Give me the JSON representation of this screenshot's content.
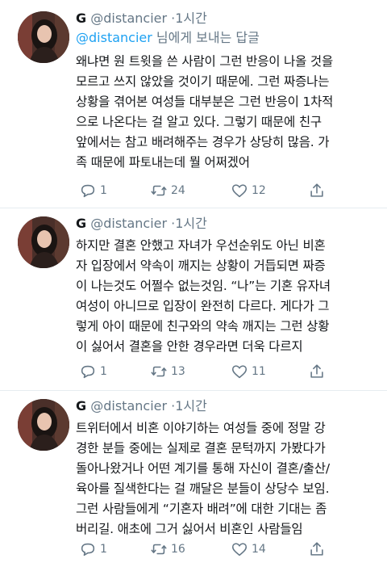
{
  "colors": {
    "link": "#1da1f2",
    "meta": "#657786",
    "text": "#14171a"
  },
  "tweets": [
    {
      "name": "G",
      "handle": "@distancier",
      "separator": "·",
      "time": "1시간",
      "reply_mention": "@distancier",
      "reply_suffix": " 님에게 보내는 답글",
      "body": "왜냐면 원 트윗을 쓴 사람이 그런 반응이 나올 것을\n모르고 쓰지 않았을 것이기 때문에. 그런 짜증나는\n상황을 겪어본 여성들 대부분은 그런 반응이 1차적\n으로 나온다는 걸 알고 있다. 그렇기 때문에 친구\n앞에서는 참고 배려해주는 경우가 상당히 많음. 가\n족 때문에 파토내는데 뭘 어쩌겠어",
      "replies": "1",
      "retweets": "24",
      "likes": "12"
    },
    {
      "name": "G",
      "handle": "@distancier",
      "separator": "·",
      "time": "1시간",
      "body": "하지만 결혼 안했고 자녀가 우선순위도 아닌 비혼\n자 입장에서 약속이 깨지는 상황이 거듭되면 짜증\n이 나는것도 어쩔수 없는것임. “나”는 기혼 유자녀\n여성이 아니므로 입장이 완전히 다르다. 게다가 그\n렇게 아이 때문에 친구와의 약속 깨지는 그런 상황\n이 싫어서 결혼을 안한 경우라면 더욱 다르지",
      "replies": "1",
      "retweets": "13",
      "likes": "11"
    },
    {
      "name": "G",
      "handle": "@distancier",
      "separator": "·",
      "time": "1시간",
      "body": "트위터에서 비혼 이야기하는 여성들 중에 정말 강\n경한 분들 중에는 실제로 결혼 문턱까지 가봤다가\n돌아나왔거나 어떤 계기를 통해 자신이 결혼/출산/\n육아를 질색한다는 걸 깨달은 분들이 상당수 보임.\n그런 사람들에게 “기혼자 배려”에 대한 기대는 좀\n버리길. 애초에 그거 싫어서 비혼인 사람들임",
      "replies": "1",
      "retweets": "16",
      "likes": "14"
    }
  ]
}
